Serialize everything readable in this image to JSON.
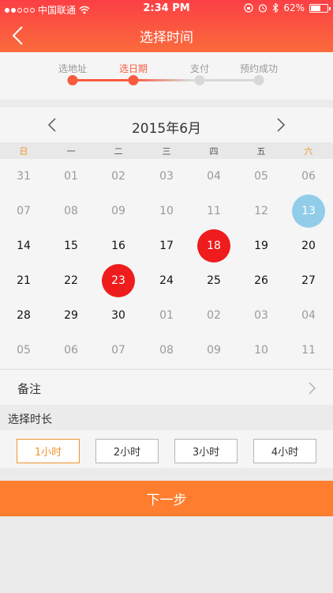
{
  "status_bar": {
    "signal_dots": [
      true,
      true,
      false,
      false,
      false
    ],
    "carrier": "中国联通",
    "time": "2:34 PM",
    "battery_text": "62%",
    "battery_level": 0.62
  },
  "nav": {
    "title": "选择时间"
  },
  "steps": [
    {
      "label": "选地址",
      "done": true,
      "active": false
    },
    {
      "label": "选日期",
      "done": true,
      "active": true
    },
    {
      "label": "支付",
      "done": false,
      "active": false
    },
    {
      "label": "预约成功",
      "done": false,
      "active": false
    }
  ],
  "calendar": {
    "month_label": "2015年6月",
    "weekdays": [
      "日",
      "一",
      "二",
      "三",
      "四",
      "五",
      "六"
    ],
    "weeks": [
      [
        {
          "d": "31",
          "m": "other"
        },
        {
          "d": "01",
          "m": "other"
        },
        {
          "d": "02",
          "m": "other"
        },
        {
          "d": "03",
          "m": "other"
        },
        {
          "d": "04",
          "m": "other"
        },
        {
          "d": "05",
          "m": "other"
        },
        {
          "d": "06",
          "m": "other"
        }
      ],
      [
        {
          "d": "07",
          "m": "other"
        },
        {
          "d": "08",
          "m": "other"
        },
        {
          "d": "09",
          "m": "other"
        },
        {
          "d": "10",
          "m": "other"
        },
        {
          "d": "11",
          "m": "other"
        },
        {
          "d": "12",
          "m": "other"
        },
        {
          "d": "13",
          "m": "today"
        }
      ],
      [
        {
          "d": "14",
          "m": "current"
        },
        {
          "d": "15",
          "m": "current"
        },
        {
          "d": "16",
          "m": "current"
        },
        {
          "d": "17",
          "m": "current"
        },
        {
          "d": "18",
          "m": "marked"
        },
        {
          "d": "19",
          "m": "current"
        },
        {
          "d": "20",
          "m": "current"
        }
      ],
      [
        {
          "d": "21",
          "m": "current"
        },
        {
          "d": "22",
          "m": "current"
        },
        {
          "d": "23",
          "m": "marked"
        },
        {
          "d": "24",
          "m": "current"
        },
        {
          "d": "25",
          "m": "current"
        },
        {
          "d": "26",
          "m": "current"
        },
        {
          "d": "27",
          "m": "current"
        }
      ],
      [
        {
          "d": "28",
          "m": "current"
        },
        {
          "d": "29",
          "m": "current"
        },
        {
          "d": "30",
          "m": "current"
        },
        {
          "d": "01",
          "m": "other"
        },
        {
          "d": "02",
          "m": "other"
        },
        {
          "d": "03",
          "m": "other"
        },
        {
          "d": "04",
          "m": "other"
        }
      ],
      [
        {
          "d": "05",
          "m": "other"
        },
        {
          "d": "06",
          "m": "other"
        },
        {
          "d": "07",
          "m": "other"
        },
        {
          "d": "08",
          "m": "other"
        },
        {
          "d": "09",
          "m": "other"
        },
        {
          "d": "10",
          "m": "other"
        },
        {
          "d": "11",
          "m": "other"
        }
      ]
    ]
  },
  "note": {
    "label": "备注"
  },
  "duration": {
    "title": "选择时长",
    "options": [
      "1小时",
      "2小时",
      "3小时",
      "4小时"
    ],
    "selected_index": 0
  },
  "next_button": {
    "label": "下一步"
  },
  "colors": {
    "header_top": "#fb3f45",
    "header_bottom": "#fb6b3c",
    "accent_orange": "#f0942c",
    "step_active": "#fa5a3f",
    "marked_day": "#ee1c1c",
    "today_day": "#91cde8",
    "next_button": "#ff7d2e"
  },
  "icons": {
    "back": "chevron-left-icon",
    "prev_month": "chevron-left-icon",
    "next_month": "chevron-right-icon",
    "note": "chevron-right-icon",
    "wifi": "wifi-icon",
    "lock": "rotation-lock-icon",
    "alarm": "alarm-icon",
    "bluetooth": "bluetooth-icon",
    "battery": "battery-icon"
  }
}
